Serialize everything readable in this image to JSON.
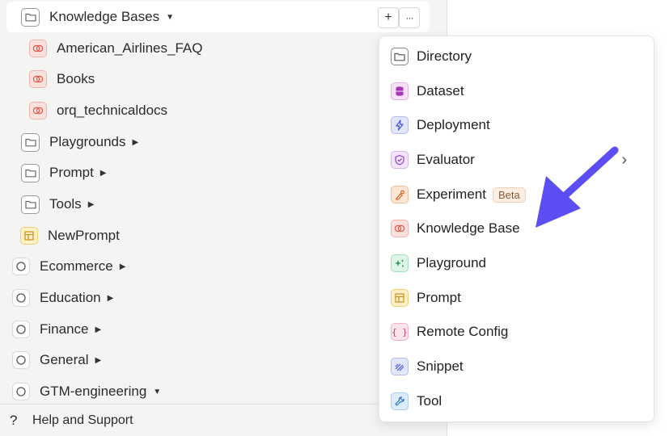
{
  "sidebar": {
    "knowledge_bases": {
      "label": "Knowledge Bases",
      "caret": "▼",
      "add_label": "+",
      "more_label": "···"
    },
    "kb_items": [
      {
        "label": "American_Airlines_FAQ"
      },
      {
        "label": "Books"
      },
      {
        "label": "orq_technicaldocs"
      }
    ],
    "folders": [
      {
        "label": "Playgrounds",
        "caret": "▶"
      },
      {
        "label": "Prompt",
        "caret": "▶"
      },
      {
        "label": "Tools",
        "caret": "▶"
      }
    ],
    "new_prompt": {
      "label": "NewPrompt"
    },
    "projects": [
      {
        "label": "Ecommerce",
        "caret": "▶"
      },
      {
        "label": "Education",
        "caret": "▶"
      },
      {
        "label": "Finance",
        "caret": "▶"
      },
      {
        "label": "General",
        "caret": "▶"
      },
      {
        "label": "GTM-engineering",
        "caret": "▼"
      }
    ],
    "footer": {
      "icon": "?",
      "label": "Help and Support"
    }
  },
  "menu": {
    "items": [
      {
        "label": "Directory",
        "icon": "folder-icon"
      },
      {
        "label": "Dataset",
        "icon": "database-icon"
      },
      {
        "label": "Deployment",
        "icon": "lightning-icon"
      },
      {
        "label": "Evaluator",
        "icon": "shield-check-icon",
        "chevron": "›"
      },
      {
        "label": "Experiment",
        "icon": "flask-icon",
        "badge": "Beta"
      },
      {
        "label": "Knowledge Base",
        "icon": "brain-icon"
      },
      {
        "label": "Playground",
        "icon": "sparkles-icon"
      },
      {
        "label": "Prompt",
        "icon": "layout-icon"
      },
      {
        "label": "Remote Config",
        "icon": "braces-icon",
        "glyph": "{ }"
      },
      {
        "label": "Snippet",
        "icon": "stripes-icon"
      },
      {
        "label": "Tool",
        "icon": "wrench-icon"
      }
    ]
  },
  "colors": {
    "arrow": "#5b4ef5",
    "kb_icon": "#e0574b"
  }
}
